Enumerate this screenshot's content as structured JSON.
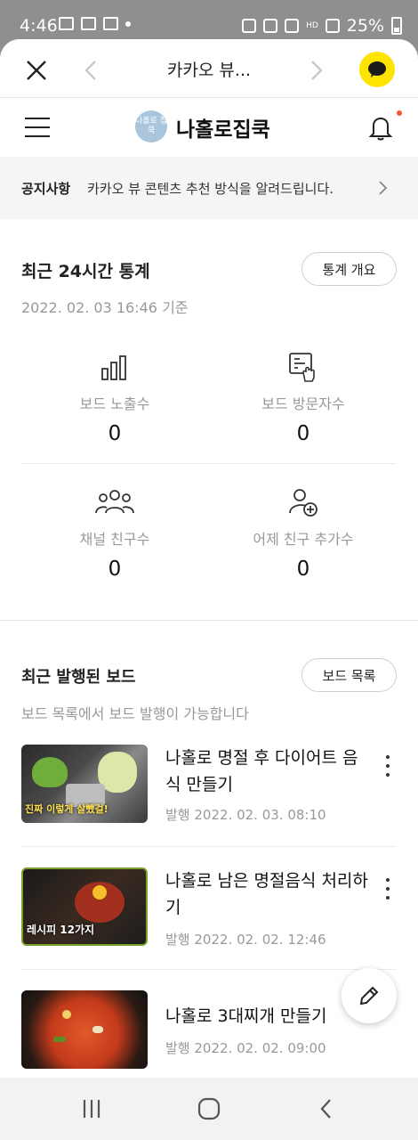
{
  "status_bar": {
    "time": "4:46",
    "battery": "25%",
    "network_text": "HD"
  },
  "topbar": {
    "title": "카카오 뷰..."
  },
  "header": {
    "brand": "나홀로집쿡",
    "logo_text": "나홀로 집쿡"
  },
  "notice": {
    "label": "공지사항",
    "text": "카카오 뷰 콘텐츠 추천 방식을 알려드립니다."
  },
  "stats": {
    "title": "최근 24시간 통계",
    "button": "통계 개요",
    "date": "2022. 02. 03 16:46 기준",
    "items": [
      {
        "label": "보드 노출수",
        "value": "0",
        "icon": "bar-chart-icon"
      },
      {
        "label": "보드 방문자수",
        "value": "0",
        "icon": "tap-card-icon"
      },
      {
        "label": "채널 친구수",
        "value": "0",
        "icon": "people-group-icon"
      },
      {
        "label": "어제 친구 추가수",
        "value": "0",
        "icon": "add-person-icon"
      }
    ]
  },
  "recent": {
    "title": "최근 발행된 보드",
    "button": "보드 목록",
    "subtitle": "보드 목록에서 보드 발행이 가능합니다",
    "boards": [
      {
        "title": "나홀로 명절 후 다이어트 음식 만들기",
        "date": "발행 2022. 02. 03. 08:10",
        "thumb_text": "진짜 이렇게 살뺐걸!"
      },
      {
        "title": "나홀로 남은 명절음식 처리하기",
        "date": "발행 2022. 02. 02. 12:46",
        "thumb_text": "레시피 12가지"
      },
      {
        "title": "나홀로 3대찌개 만들기",
        "date": "발행 2022. 02. 02. 09:00",
        "thumb_text": ""
      }
    ]
  },
  "colors": {
    "kakao_yellow": "#fee500",
    "notice_bg": "#f5f5f5",
    "muted_text": "#999999",
    "alert_dot": "#f05a28"
  }
}
